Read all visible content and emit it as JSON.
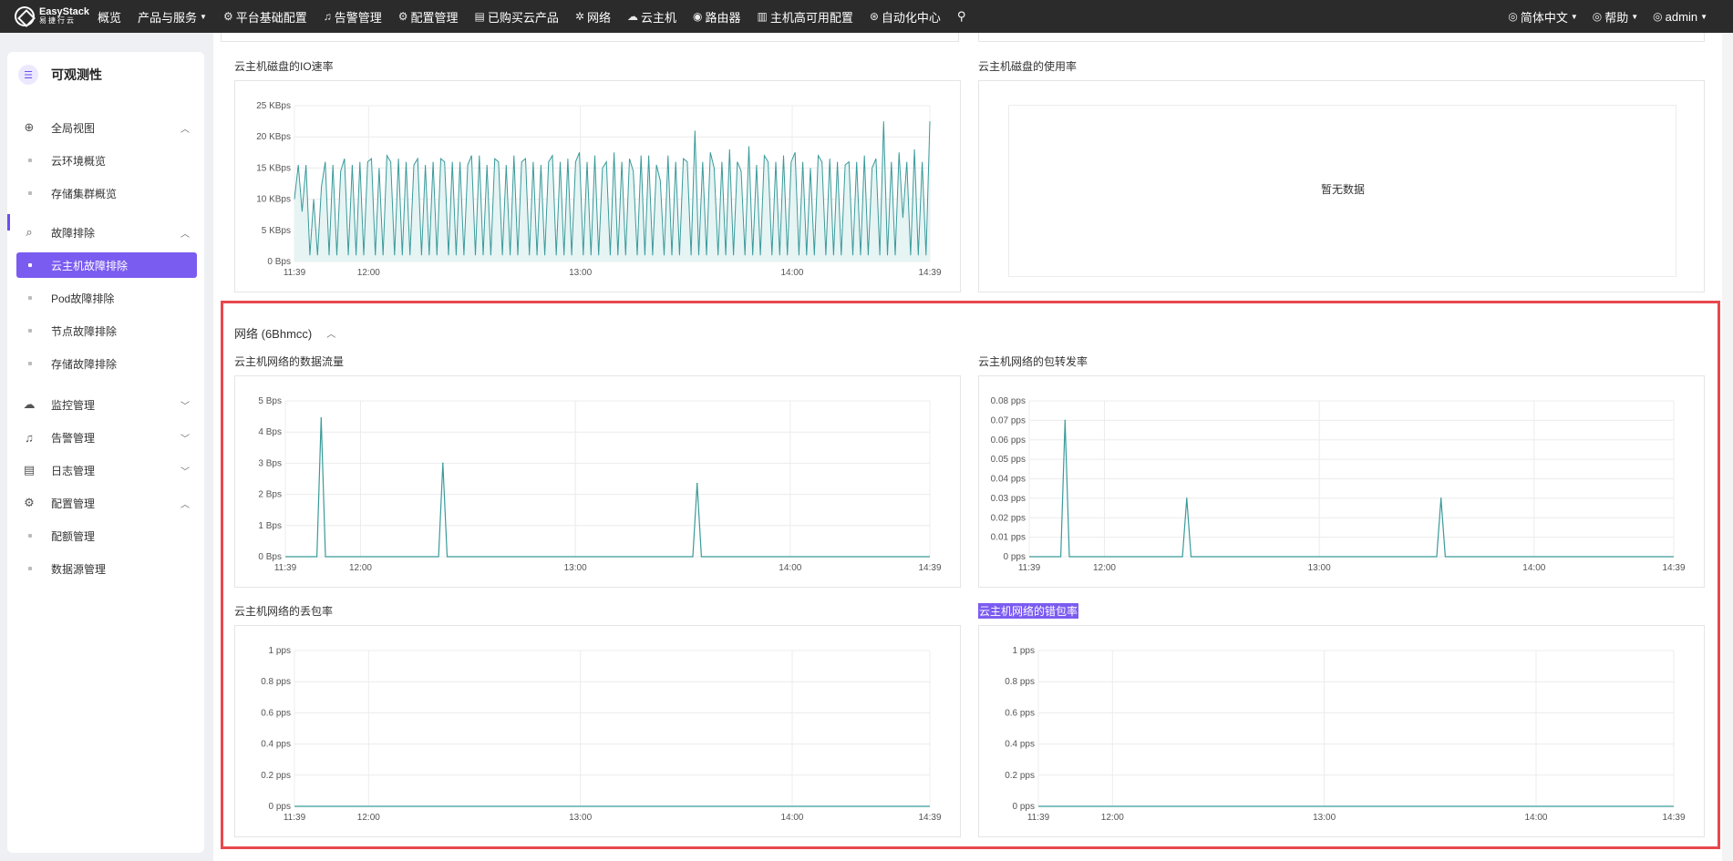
{
  "brand": {
    "name": "EasyStack",
    "sub": "易捷行云"
  },
  "nav": {
    "items": [
      {
        "label": "概览",
        "icon": "",
        "caret": false
      },
      {
        "label": "产品与服务",
        "icon": "",
        "caret": true
      },
      {
        "label": "平台基础配置",
        "icon": "gear-icon",
        "caret": false
      },
      {
        "label": "告警管理",
        "icon": "bell-icon",
        "caret": false
      },
      {
        "label": "配置管理",
        "icon": "gear-icon",
        "caret": false
      },
      {
        "label": "已购买云产品",
        "icon": "list-icon",
        "caret": false
      },
      {
        "label": "网络",
        "icon": "network-icon",
        "caret": false
      },
      {
        "label": "云主机",
        "icon": "cloud-icon",
        "caret": false
      },
      {
        "label": "路由器",
        "icon": "router-icon",
        "caret": false
      },
      {
        "label": "主机高可用配置",
        "icon": "ha-icon",
        "caret": false
      },
      {
        "label": "自动化中心",
        "icon": "auto-icon",
        "caret": false
      }
    ],
    "language": "简体中文",
    "help": "帮助",
    "user": "admin"
  },
  "sidebar": {
    "title": "可观测性",
    "items": [
      {
        "label": "全局视图",
        "type": "group",
        "icon": "globe-icon",
        "expanded": true
      },
      {
        "label": "云环境概览",
        "type": "sub"
      },
      {
        "label": "存储集群概览",
        "type": "sub"
      },
      {
        "label": "故障排除",
        "type": "group",
        "icon": "diagnose-icon",
        "expanded": true
      },
      {
        "label": "云主机故障排除",
        "type": "sub",
        "active": true
      },
      {
        "label": "Pod故障排除",
        "type": "sub"
      },
      {
        "label": "节点故障排除",
        "type": "sub"
      },
      {
        "label": "存储故障排除",
        "type": "sub"
      },
      {
        "label": "监控管理",
        "type": "group",
        "icon": "monitor-icon",
        "expanded": false
      },
      {
        "label": "告警管理",
        "type": "group",
        "icon": "alarm-icon",
        "expanded": false
      },
      {
        "label": "日志管理",
        "type": "group",
        "icon": "log-icon",
        "expanded": false
      },
      {
        "label": "配置管理",
        "type": "group",
        "icon": "config-icon",
        "expanded": true
      },
      {
        "label": "配额管理",
        "type": "sub"
      },
      {
        "label": "数据源管理",
        "type": "sub"
      }
    ]
  },
  "panels": {
    "disk_io_title": "云主机磁盘的IO速率",
    "disk_usage_title": "云主机磁盘的使用率",
    "disk_usage_empty": "暂无数据",
    "network_section": "网络 (6Bhmcc)",
    "net_traffic_title": "云主机网络的数据流量",
    "net_pps_title": "云主机网络的包转发率",
    "net_drop_title": "云主机网络的丢包率",
    "net_error_title": "云主机网络的错包率"
  },
  "colors": {
    "line": "#3a9a9a",
    "fill": "#e6f4f4",
    "accent": "#7b5cf0",
    "highlight_frame": "#e8474e"
  },
  "chart_data": [
    {
      "type": "area",
      "title": "云主机磁盘的IO速率",
      "xticks": [
        "11:39",
        "12:00",
        "13:00",
        "14:00",
        "14:39"
      ],
      "x_minutes": [
        0,
        21,
        81,
        141,
        180
      ],
      "yticks": [
        "0 Bps",
        "5 KBps",
        "10 KBps",
        "15 KBps",
        "20 KBps",
        "25 KBps"
      ],
      "ylim": [
        0,
        25
      ],
      "unit": "KBps",
      "series": [
        {
          "values": [
            10,
            15.5,
            8,
            15.5,
            1,
            10,
            1,
            12,
            16,
            1,
            15.5,
            1,
            14.5,
            16.5,
            1,
            15.5,
            1,
            16,
            1,
            16,
            16.5,
            1,
            15,
            1,
            17,
            16,
            1,
            16.5,
            1,
            16,
            1,
            15.5,
            16.5,
            1,
            15.5,
            1,
            16,
            1,
            16.5,
            16,
            1,
            16,
            1,
            16,
            1,
            15.5,
            17,
            1,
            17,
            1,
            15.5,
            1,
            16.5,
            16,
            1,
            15.5,
            1,
            17,
            1,
            16,
            16.5,
            1,
            16,
            1,
            15.5,
            1,
            16,
            17,
            1,
            16,
            1,
            16.5,
            1,
            16,
            17.5,
            1,
            16,
            1,
            17,
            1,
            15,
            16,
            1,
            17.5,
            1,
            16,
            1,
            16.5,
            14.5,
            1,
            17,
            1,
            17,
            1,
            15.5,
            13,
            1,
            17,
            1,
            16,
            1,
            16.5,
            16,
            1,
            21,
            1,
            16,
            1,
            17.5,
            15,
            1,
            16,
            1,
            18,
            1,
            16,
            14.5,
            1,
            18.5,
            1,
            15.5,
            1,
            17,
            16,
            1,
            16,
            1,
            17,
            1,
            16,
            17.5,
            1,
            16,
            1,
            15,
            1,
            17,
            16,
            1,
            16.5,
            1,
            16,
            1,
            15.5,
            16,
            1,
            16,
            1,
            17,
            1,
            15,
            16.5,
            1,
            22.5,
            1,
            16,
            1,
            17.5,
            7,
            16,
            1,
            18,
            1,
            16,
            1,
            22.5
          ]
        }
      ]
    },
    {
      "type": "line",
      "title": "云主机网络的数据流量",
      "xticks": [
        "11:39",
        "12:00",
        "13:00",
        "14:00",
        "14:39"
      ],
      "x_minutes": [
        0,
        21,
        81,
        141,
        180
      ],
      "yticks": [
        "0 Bps",
        "1 Bps",
        "2 Bps",
        "3 Bps",
        "4 Bps",
        "5 Bps"
      ],
      "ylim": [
        0,
        5
      ],
      "spikes": [
        {
          "x": 10,
          "y": 4.45
        },
        {
          "x": 44,
          "y": 3.0
        },
        {
          "x": 115,
          "y": 2.35
        }
      ]
    },
    {
      "type": "line",
      "title": "云主机网络的包转发率",
      "xticks": [
        "11:39",
        "12:00",
        "13:00",
        "14:00",
        "14:39"
      ],
      "x_minutes": [
        0,
        21,
        81,
        141,
        180
      ],
      "yticks": [
        "0 pps",
        "0.01 pps",
        "0.02 pps",
        "0.03 pps",
        "0.04 pps",
        "0.05 pps",
        "0.06 pps",
        "0.07 pps",
        "0.08 pps"
      ],
      "ylim": [
        0,
        0.08
      ],
      "spikes": [
        {
          "x": 10,
          "y": 0.07
        },
        {
          "x": 44,
          "y": 0.03
        },
        {
          "x": 115,
          "y": 0.03
        }
      ]
    },
    {
      "type": "line",
      "title": "云主机网络的丢包率",
      "xticks": [
        "11:39",
        "12:00",
        "13:00",
        "14:00",
        "14:39"
      ],
      "x_minutes": [
        0,
        21,
        81,
        141,
        180
      ],
      "yticks": [
        "0 pps",
        "0.2 pps",
        "0.4 pps",
        "0.6 pps",
        "0.8 pps",
        "1 pps"
      ],
      "ylim": [
        0,
        1
      ],
      "spikes": []
    },
    {
      "type": "line",
      "title": "云主机网络的错包率",
      "xticks": [
        "11:39",
        "12:00",
        "13:00",
        "14:00",
        "14:39"
      ],
      "x_minutes": [
        0,
        21,
        81,
        141,
        180
      ],
      "yticks": [
        "0 pps",
        "0.2 pps",
        "0.4 pps",
        "0.6 pps",
        "0.8 pps",
        "1 pps"
      ],
      "ylim": [
        0,
        1
      ],
      "spikes": []
    }
  ]
}
